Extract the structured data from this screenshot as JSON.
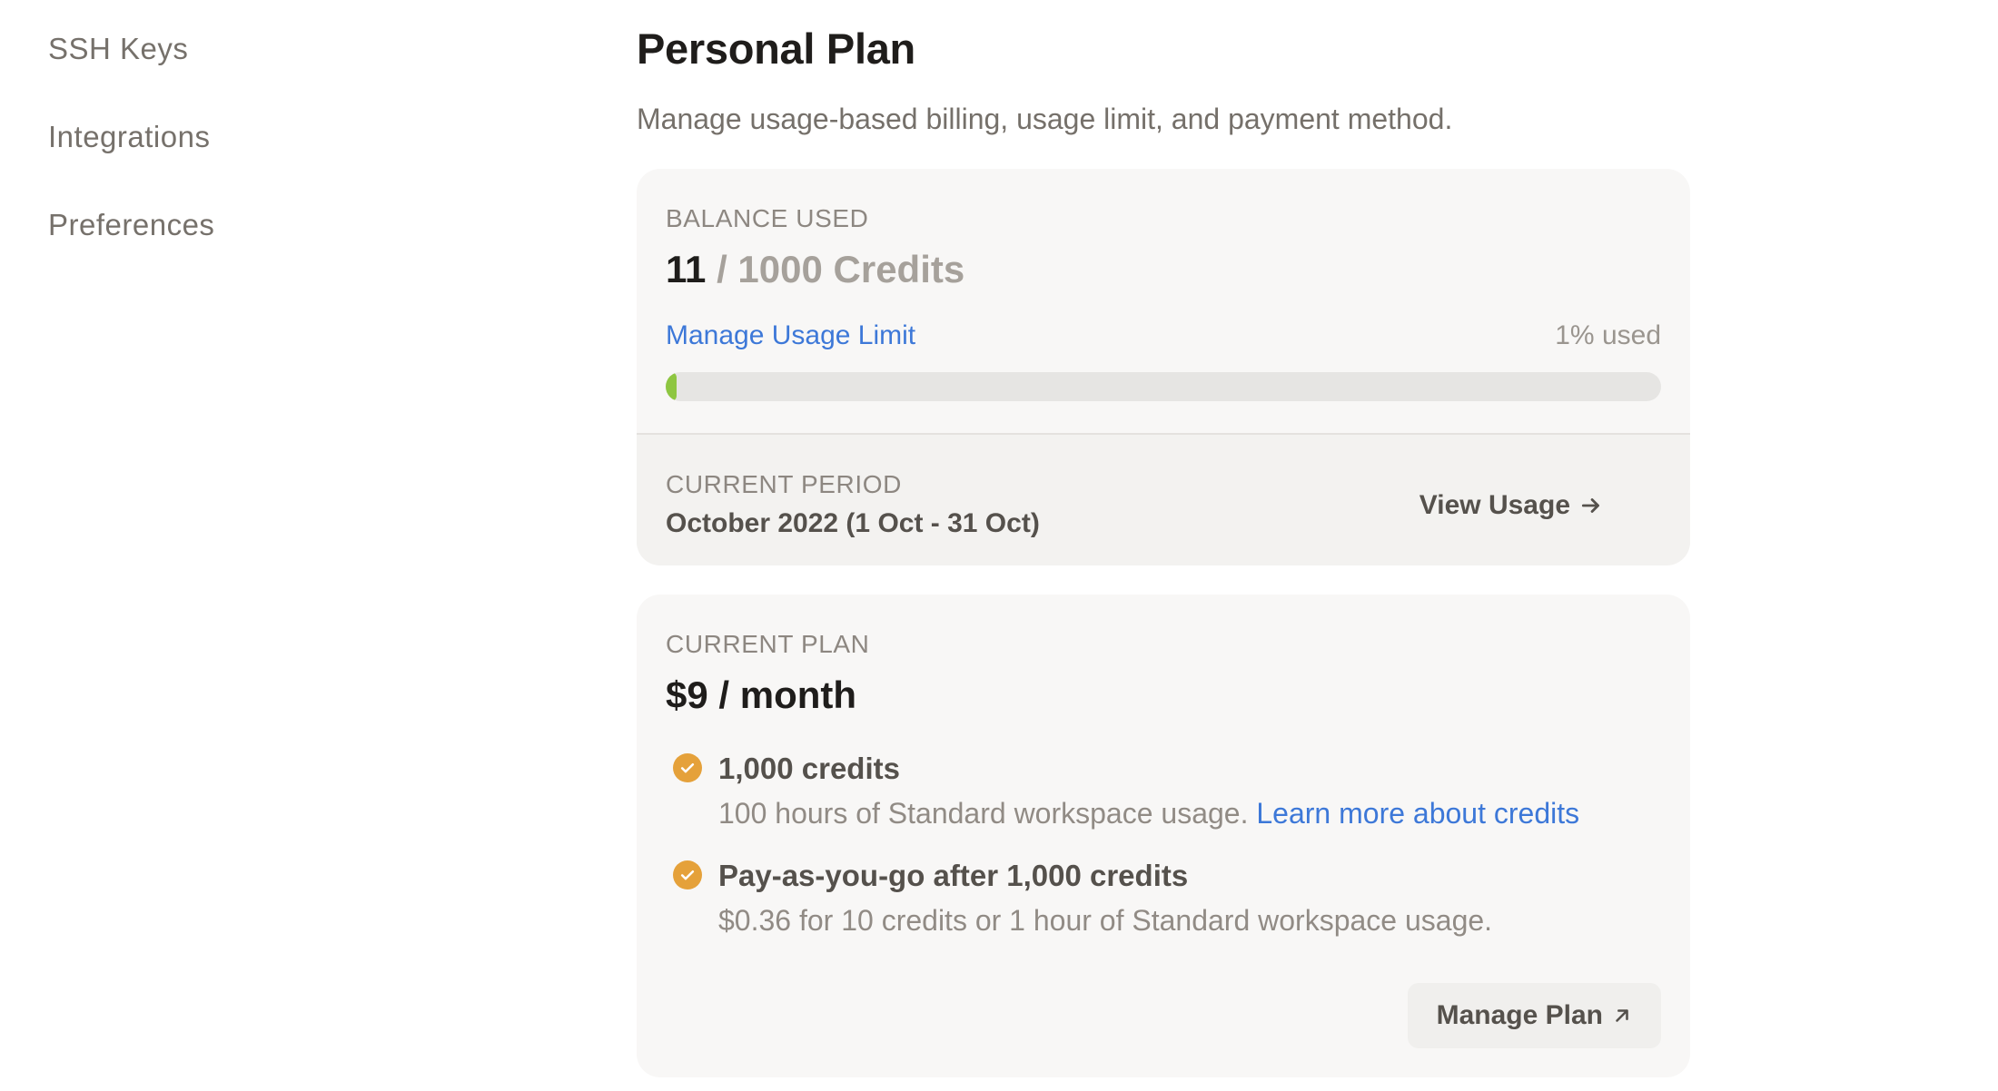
{
  "sidebar": {
    "items": [
      {
        "label": "SSH Keys"
      },
      {
        "label": "Integrations"
      },
      {
        "label": "Preferences"
      }
    ]
  },
  "header": {
    "title": "Personal Plan",
    "subtitle": "Manage usage-based billing, usage limit, and payment method."
  },
  "balance": {
    "eyebrow": "BALANCE USED",
    "used": "11",
    "total_text": " / 1000 Credits",
    "manage_limit_label": "Manage Usage Limit",
    "percent_label": "1% used",
    "progress_fraction": 0.011
  },
  "period": {
    "eyebrow": "CURRENT PERIOD",
    "value": "October 2022 (1 Oct - 31 Oct)",
    "view_usage_label": "View Usage"
  },
  "plan": {
    "eyebrow": "CURRENT PLAN",
    "price": "$9 / month",
    "features": [
      {
        "title": "1,000 credits",
        "desc": "100 hours of Standard workspace usage. ",
        "link": "Learn more about credits"
      },
      {
        "title": "Pay-as-you-go after 1,000 credits",
        "desc": "$0.36 for 10 credits or 1 hour of Standard workspace usage."
      }
    ],
    "manage_label": "Manage Plan"
  },
  "colors": {
    "accent_link": "#3d78d8",
    "progress": "#8ec641",
    "check": "#e5a13a"
  },
  "icons": {
    "view_usage": "arrow-right-icon",
    "manage_plan": "arrow-up-right-icon",
    "feature_check": "check-circle-icon"
  }
}
